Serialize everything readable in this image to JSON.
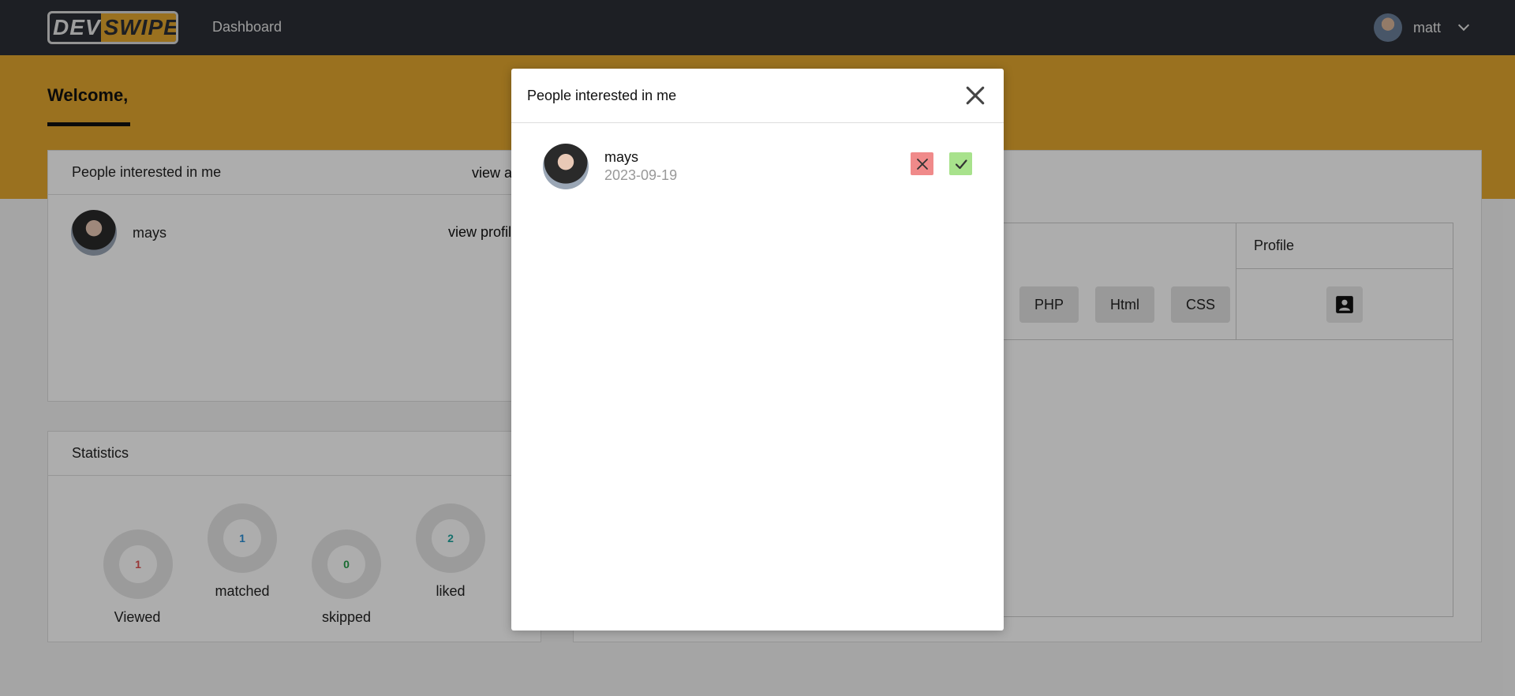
{
  "navbar": {
    "logo_dev": "DEV",
    "logo_swipe": "SWIPE",
    "dashboard_link": "Dashboard",
    "username": "matt"
  },
  "banner": {
    "welcome": "Welcome,"
  },
  "interest_card": {
    "title": "People interested in me",
    "view_all": "view a",
    "items": [
      {
        "name": "mays",
        "action": "view profil"
      }
    ]
  },
  "stats_card": {
    "title": "Statistics",
    "items": [
      {
        "label": "Viewed",
        "value": "1",
        "color": "#e05252"
      },
      {
        "label": "matched",
        "value": "1",
        "color": "#2b8fd6"
      },
      {
        "label": "skipped",
        "value": "0",
        "color": "#27a04a"
      },
      {
        "label": "liked",
        "value": "2",
        "color": "#20a6a0"
      }
    ]
  },
  "right_card": {
    "profile_header": "Profile",
    "skills": [
      "PHP",
      "Html",
      "CSS"
    ]
  },
  "modal": {
    "title": "People interested in me",
    "items": [
      {
        "name": "mays",
        "date": "2023-09-19"
      }
    ]
  },
  "colors": {
    "brand": "#e3a72f",
    "navbar": "#2b2f36",
    "reject": "#f08a8a",
    "accept": "#a8e28c"
  },
  "icons": {
    "close": "close-icon",
    "reject": "x-icon",
    "accept": "check-icon",
    "profile": "contact-card-icon",
    "dropdown": "chevron-down-icon"
  }
}
